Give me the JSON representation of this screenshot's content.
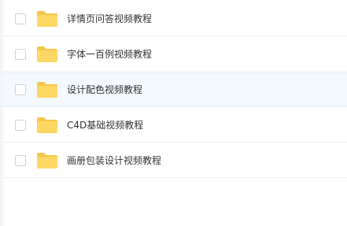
{
  "files": [
    {
      "name": "详情页问答视频教程",
      "icon": "folder-icon",
      "selected": false
    },
    {
      "name": "字体一百例视频教程",
      "icon": "folder-icon",
      "selected": false
    },
    {
      "name": "设计配色视频教程",
      "icon": "folder-icon",
      "selected": true
    },
    {
      "name": "C4D基础视频教程",
      "icon": "folder-icon",
      "selected": false
    },
    {
      "name": "画册包装设计视频教程",
      "icon": "folder-icon",
      "selected": false
    }
  ],
  "colors": {
    "folder_body": "#fdd764",
    "folder_tab": "#f7c74a",
    "selected_row_bg": "#f3f9fe",
    "text": "#333333"
  }
}
